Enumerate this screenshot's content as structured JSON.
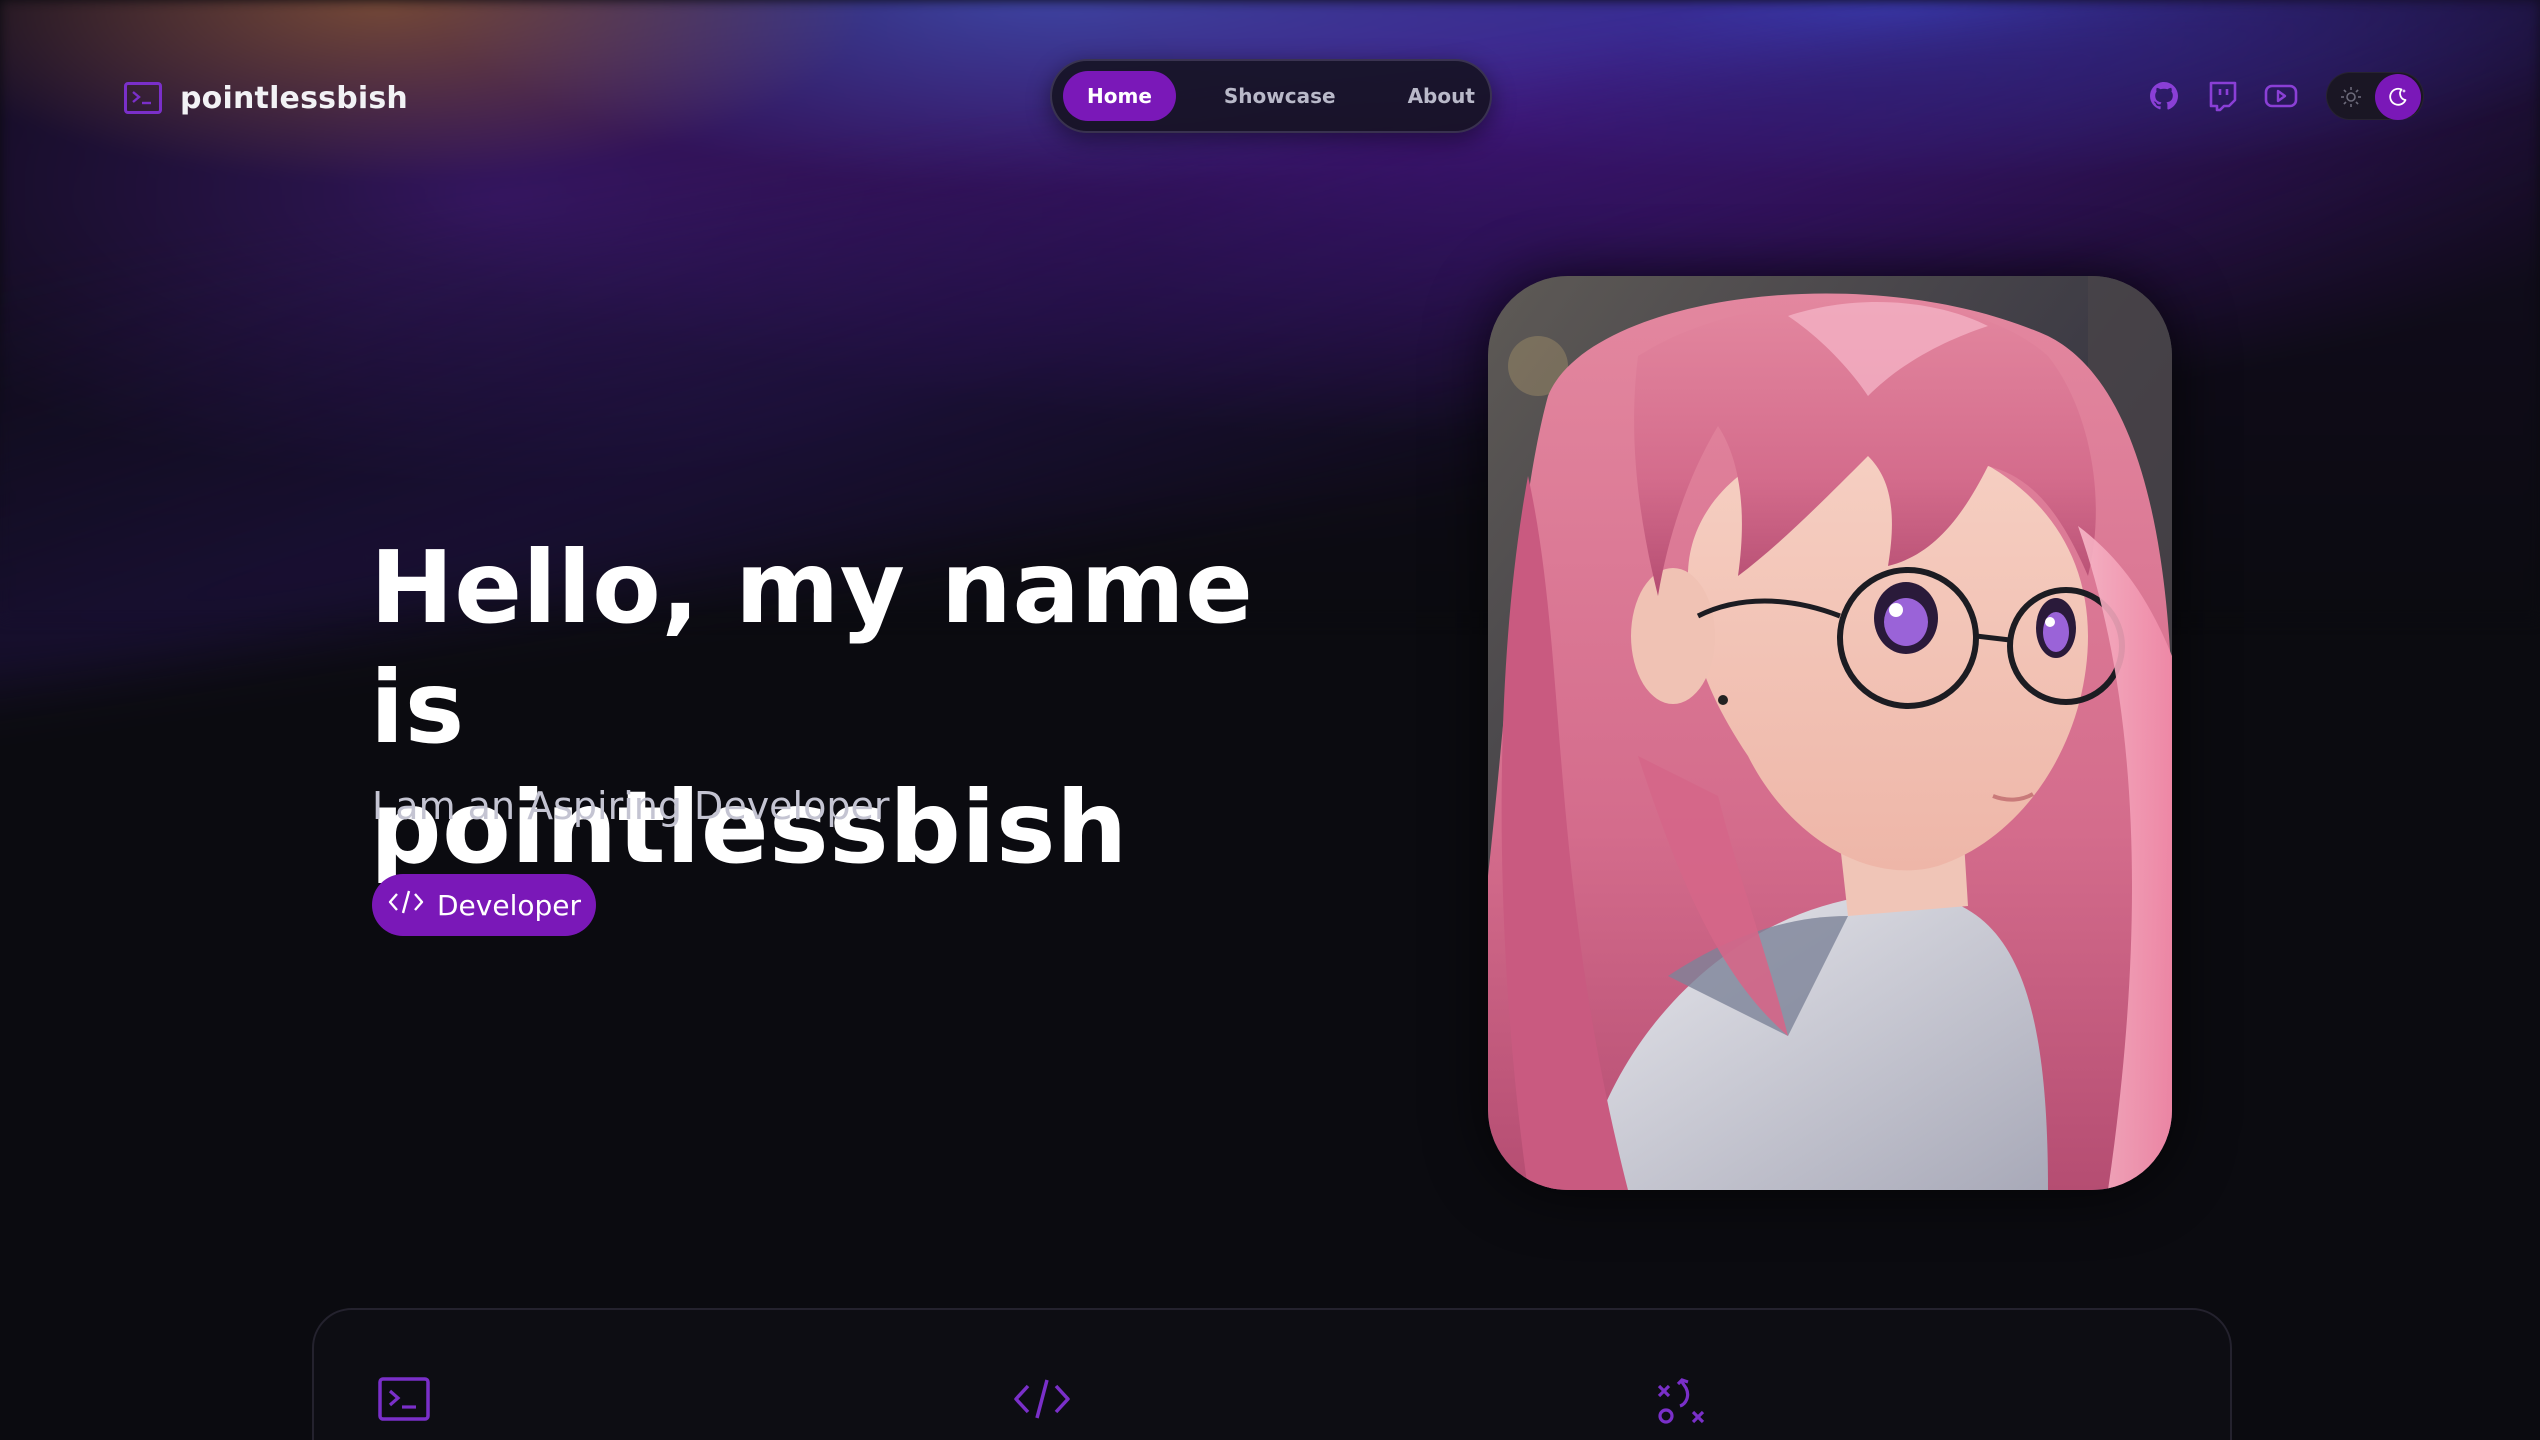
{
  "brand": {
    "name": "pointlessbish",
    "icon": "terminal-icon"
  },
  "nav": {
    "items": [
      {
        "label": "Home",
        "active": true
      },
      {
        "label": "Showcase",
        "active": false
      },
      {
        "label": "About",
        "active": false
      }
    ]
  },
  "social": [
    {
      "icon": "github-icon"
    },
    {
      "icon": "twitch-icon"
    },
    {
      "icon": "youtube-icon"
    }
  ],
  "theme_toggle": {
    "light_icon": "sun-icon",
    "dark_icon": "moon-icon",
    "selected": "dark"
  },
  "hero": {
    "title_line1": "Hello, my name is",
    "title_line2": "pointlessbish",
    "subtitle": "I am an Aspiring Developer",
    "role_label": "Developer",
    "role_icon": "code-icon"
  },
  "portrait": {
    "subject": "anime-style girl with long pink hair and round glasses"
  },
  "features": [
    {
      "icon": "terminal-icon"
    },
    {
      "icon": "code-icon"
    },
    {
      "icon": "strategy-icon"
    }
  ],
  "colors": {
    "accent": "#7a18b8",
    "accent_icon": "#8a3fd6",
    "background": "#0b0b10",
    "nav_text": "#b9b9c9",
    "subtitle_text": "#c4c4d2"
  }
}
